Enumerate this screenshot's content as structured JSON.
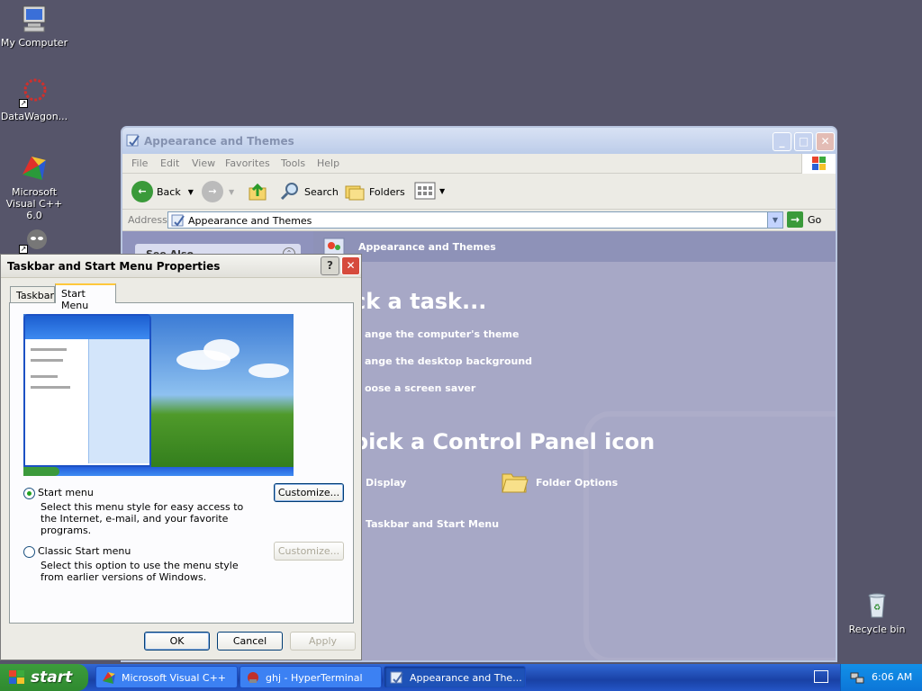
{
  "desktop": {
    "icons": [
      {
        "label": "My Computer",
        "icon": "computer-icon"
      },
      {
        "label": "DataWagon...",
        "icon": "datawagon-icon"
      },
      {
        "label": "Microsoft Visual C++ 6.0",
        "icon": "visual-cpp-icon"
      },
      {
        "label": "Recycle bin",
        "icon": "recycle-bin-icon"
      }
    ]
  },
  "explorer": {
    "title": "Appearance and Themes",
    "menu": [
      "File",
      "Edit",
      "View",
      "Favorites",
      "Tools",
      "Help"
    ],
    "toolbar": {
      "back": "Back",
      "search": "Search",
      "folders": "Folders"
    },
    "address": {
      "label": "Address",
      "value": "Appearance and Themes",
      "go": "Go"
    },
    "left_pane": {
      "see_also": "See Also"
    },
    "header": "Appearance and Themes",
    "pick_task": "ck a task...",
    "tasks": [
      "ange the computer's theme",
      "ange the desktop background",
      "oose a screen saver"
    ],
    "pick_icon": "pick a Control Panel icon",
    "icons": [
      "Display",
      "Folder Options",
      "Taskbar and Start Menu"
    ]
  },
  "dialog": {
    "title": "Taskbar and Start Menu Properties",
    "tabs": [
      "Taskbar",
      "Start Menu"
    ],
    "active_tab": "Start Menu",
    "options": [
      {
        "label": "Start menu",
        "desc": "Select this menu style for easy access to the Internet, e-mail, and your favorite programs.",
        "selected": true,
        "customize": "Customize..."
      },
      {
        "label": "Classic Start menu",
        "desc": "Select this option to use the menu style from earlier versions of Windows.",
        "selected": false,
        "customize": "Customize..."
      }
    ],
    "buttons": {
      "ok": "OK",
      "cancel": "Cancel",
      "apply": "Apply"
    }
  },
  "taskbar": {
    "start": "start",
    "items": [
      {
        "label": "Microsoft Visual C++",
        "icon": "visual-cpp-icon"
      },
      {
        "label": "ghj - HyperTerminal",
        "icon": "hyperterminal-icon"
      },
      {
        "label": "Appearance and The...",
        "icon": "control-panel-icon",
        "active": true
      }
    ],
    "clock": "6:06 AM"
  },
  "colors": {
    "desktop": "#56556a",
    "taskbar": "#245edb",
    "start_button": "#3c9c3c"
  }
}
